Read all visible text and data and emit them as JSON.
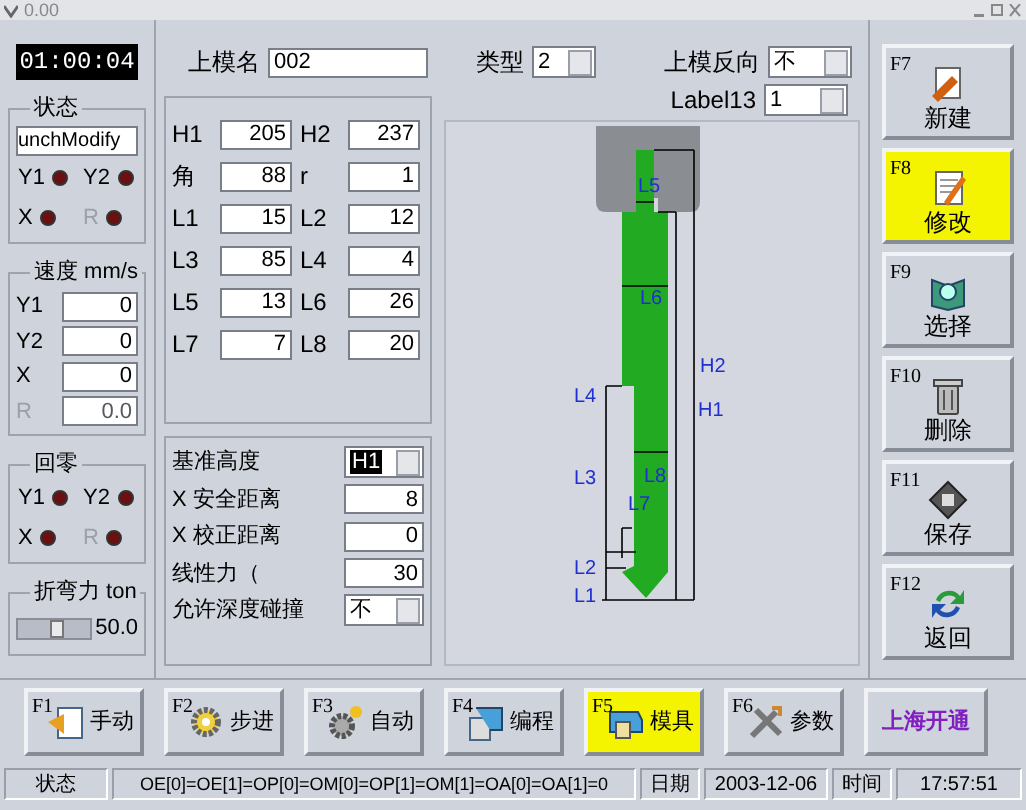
{
  "window": {
    "title": "0.00"
  },
  "clock": "01:00:04",
  "status_group": {
    "title": "状态",
    "value": "unchModify",
    "lamps": [
      {
        "label": "Y1",
        "disabled": false
      },
      {
        "label": "Y2",
        "disabled": false
      },
      {
        "label": "X",
        "disabled": false
      },
      {
        "label": "R",
        "disabled": true
      }
    ]
  },
  "speed_group": {
    "title": "速度 mm/s",
    "rows": [
      {
        "label": "Y1",
        "value": "0",
        "disabled": false
      },
      {
        "label": "Y2",
        "value": "0",
        "disabled": false
      },
      {
        "label": "X",
        "value": "0",
        "disabled": false
      },
      {
        "label": "R",
        "value": "0.0",
        "disabled": true
      }
    ]
  },
  "home_group": {
    "title": "回零",
    "lamps": [
      {
        "label": "Y1",
        "disabled": false
      },
      {
        "label": "Y2",
        "disabled": false
      },
      {
        "label": "X",
        "disabled": false
      },
      {
        "label": "R",
        "disabled": true
      }
    ]
  },
  "force_group": {
    "title": "折弯力 ton",
    "level": 0.55,
    "reading": "50.0"
  },
  "die_name": {
    "label": "上模名",
    "value": "002"
  },
  "type_select": {
    "label": "类型",
    "value": "2"
  },
  "reverse_select": {
    "label": "上模反向",
    "value": "不"
  },
  "label13_select": {
    "label": "Label13",
    "value": "1"
  },
  "params": [
    {
      "label": "H1",
      "value": "205"
    },
    {
      "label": "H2",
      "value": "237"
    },
    {
      "label": "角",
      "value": "88"
    },
    {
      "label": "r",
      "value": "1"
    },
    {
      "label": "L1",
      "value": "15"
    },
    {
      "label": "L2",
      "value": "12"
    },
    {
      "label": "L3",
      "value": "85"
    },
    {
      "label": "L4",
      "value": "4"
    },
    {
      "label": "L5",
      "value": "13"
    },
    {
      "label": "L6",
      "value": "26"
    },
    {
      "label": "L7",
      "value": "7"
    },
    {
      "label": "L8",
      "value": "20"
    }
  ],
  "settings": [
    {
      "kind": "dropdown",
      "label": "基准高度",
      "value": "H1",
      "highlighted": true
    },
    {
      "kind": "field",
      "label": "X 安全距离",
      "value": "8"
    },
    {
      "kind": "field",
      "label": "X 校正距离",
      "value": "0"
    },
    {
      "kind": "field",
      "label": "线性力（",
      "value": "30"
    },
    {
      "kind": "dropdown",
      "label": "允许深度碰撞",
      "value": "不",
      "highlighted": false
    }
  ],
  "diagram": {
    "labels": [
      "L5",
      "L6",
      "L4",
      "H2",
      "H1",
      "L8",
      "L3",
      "L7",
      "L2",
      "L1"
    ]
  },
  "side_buttons": [
    {
      "key": "F7",
      "label": "新建",
      "selected": false
    },
    {
      "key": "F8",
      "label": "修改",
      "selected": true
    },
    {
      "key": "F9",
      "label": "选择",
      "selected": false
    },
    {
      "key": "F10",
      "label": "删除",
      "selected": false
    },
    {
      "key": "F11",
      "label": "保存",
      "selected": false
    },
    {
      "key": "F12",
      "label": "返回",
      "selected": false
    }
  ],
  "bottom_buttons": [
    {
      "key": "F1",
      "label": "手动",
      "selected": false
    },
    {
      "key": "F2",
      "label": "步进",
      "selected": false
    },
    {
      "key": "F3",
      "label": "自动",
      "selected": false
    },
    {
      "key": "F4",
      "label": "编程",
      "selected": false
    },
    {
      "key": "F5",
      "label": "模具",
      "selected": true
    },
    {
      "key": "F6",
      "label": "参数",
      "selected": false
    }
  ],
  "logo_button": "上海开通",
  "status_bar": [
    "状态",
    "OE[0]=OE[1]=OP[0]=OM[0]=OP[1]=OM[1]=OA[0]=OA[1]=0",
    "日期",
    "2003-12-06",
    "时间",
    "17:57:51"
  ]
}
